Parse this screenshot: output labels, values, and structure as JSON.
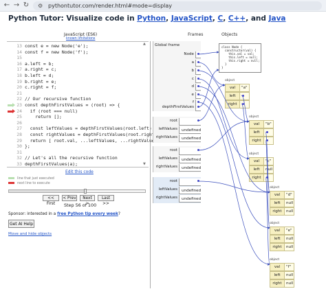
{
  "browser": {
    "url": "pythontutor.com/render.html#mode=display",
    "tune_icon": "tune-icon",
    "back_icon": "back-arrow-icon",
    "forward_icon": "forward-arrow-icon",
    "reload_icon": "reload-icon"
  },
  "title": {
    "prefix": "Python Tutor: Visualize code in ",
    "langs": [
      "Python",
      "JavaScript",
      "C",
      "C++",
      "Java"
    ],
    "sep1": ", ",
    "sep2": ", ",
    "sep3": ", ",
    "sep4": ", and "
  },
  "code": {
    "language": "JavaScript (ES6)",
    "known_limitations": "known limitations",
    "lines": [
      {
        "n": "13",
        "t": "const e = new Node('e');"
      },
      {
        "n": "14",
        "t": "const f = new Node('f');"
      },
      {
        "n": "15",
        "t": ""
      },
      {
        "n": "16",
        "t": "a.left = b;"
      },
      {
        "n": "17",
        "t": "a.right = c;"
      },
      {
        "n": "18",
        "t": "b.left = d;"
      },
      {
        "n": "19",
        "t": "b.right = e;"
      },
      {
        "n": "20",
        "t": "c.right = f;"
      },
      {
        "n": "21",
        "t": ""
      },
      {
        "n": "22",
        "t": "// Our recursive function"
      },
      {
        "n": "23",
        "t": "const depthFirstValues = (root) => {"
      },
      {
        "n": "24",
        "t": "  if (root === null)"
      },
      {
        "n": "25",
        "t": "    return [];"
      },
      {
        "n": "26",
        "t": ""
      },
      {
        "n": "27",
        "t": "  const leftValues = depthFirstValues(root.left);"
      },
      {
        "n": "28",
        "t": "  const rightValues = depthFirstValues(root.right)"
      },
      {
        "n": "29",
        "t": "  return [ root.val, ...leftValues, ...rightValues"
      },
      {
        "n": "30",
        "t": "};"
      },
      {
        "n": "31",
        "t": ""
      },
      {
        "n": "32",
        "t": "// Let's all the recursive function"
      },
      {
        "n": "33",
        "t": "depthFirstValues(a);"
      }
    ],
    "edit_link": "Edit this code",
    "legend_executed": "line that just executed",
    "legend_next": "next line to execute",
    "step_progress": 0.56
  },
  "controls": {
    "first": "<< First",
    "prev": "< Prev",
    "next": "Next >",
    "last": "Last >>",
    "step_text": "Step 56 of 100"
  },
  "sponsor": {
    "text": "Sponsor: interested in a ",
    "link": "free Python tip every week",
    "suffix": "?"
  },
  "get_ai_help": "Get AI Help",
  "move_hide": "Move and hide objects",
  "viz": {
    "frames_header": "Frames",
    "objects_header": "Objects",
    "global_frame": "Global frame",
    "global_vars": [
      "Node",
      "a",
      "b",
      "c",
      "d",
      "e",
      "f",
      "depthFirstValues"
    ],
    "frames": [
      {
        "vars": [
          {
            "name": "root",
            "value": ""
          },
          {
            "name": "leftValues",
            "value": "undefined"
          },
          {
            "name": "rightValues",
            "value": "undefined"
          }
        ]
      },
      {
        "vars": [
          {
            "name": "root",
            "value": ""
          },
          {
            "name": "leftValues",
            "value": "undefined"
          },
          {
            "name": "rightValues",
            "value": "undefined"
          }
        ]
      },
      {
        "vars": [
          {
            "name": "root",
            "value": ""
          },
          {
            "name": "leftValues",
            "value": "undefined"
          },
          {
            "name": "rightValues",
            "value": "undefined"
          }
        ]
      }
    ],
    "class_code": "class Node {\n  constructor(val) {\n    this.val = val;\n    this.left = null;\n    this.right = null;\n  }\n}",
    "object_label": "object",
    "objects": [
      {
        "val": "\"a\"",
        "left": "",
        "right": ""
      },
      {
        "val": "\"b\"",
        "left": "",
        "right": ""
      },
      {
        "val": "\"c\"",
        "left": "null",
        "right": ""
      },
      {
        "val": "\"d\"",
        "left": "null",
        "right": "null"
      },
      {
        "val": "\"e\"",
        "left": "null",
        "right": "null"
      },
      {
        "val": "\"f\"",
        "left": "null",
        "right": "null"
      }
    ],
    "field_val": "val",
    "field_left": "left",
    "field_right": "right"
  },
  "colors": {
    "object_bg": "#f7f0c2",
    "active_frame": "#e2ebf6",
    "pointer": "#3b4fbd",
    "next_line_arrow": "#dd3333",
    "executed_arrow": "#b8dfb0"
  }
}
